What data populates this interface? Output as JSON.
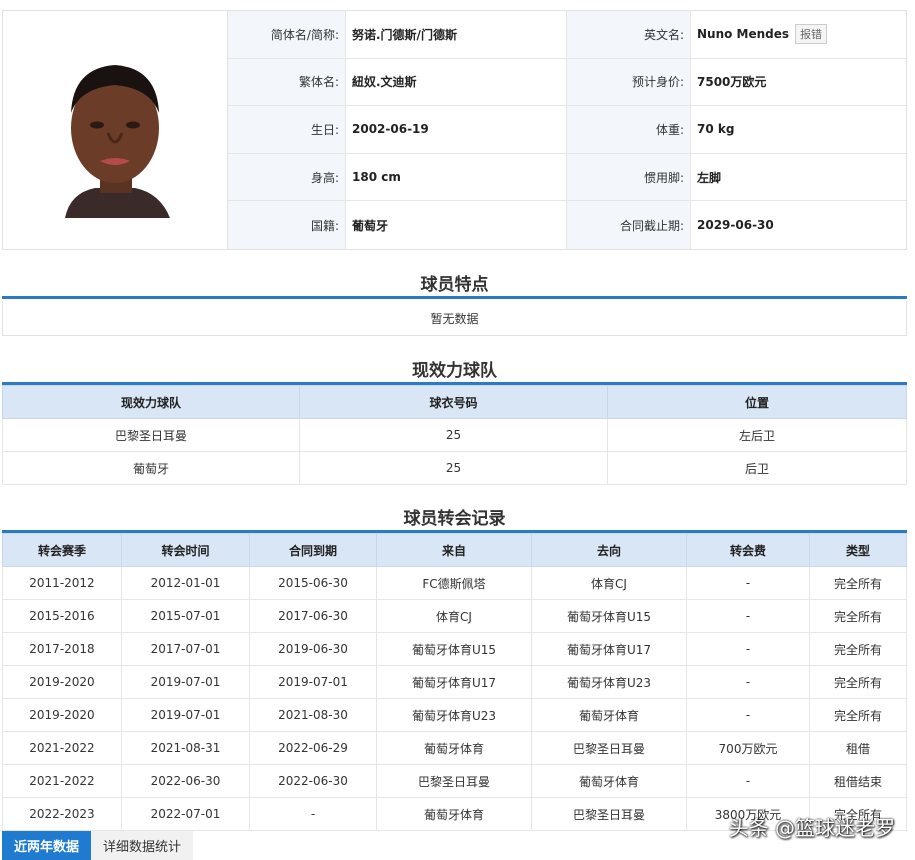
{
  "profile": {
    "rows": [
      {
        "l1": "简体名/简称:",
        "v1": "努诺.门德斯/门德斯",
        "l2": "英文名:",
        "v2": "Nuno Mendes"
      },
      {
        "l1": "繁体名:",
        "v1": "紐奴.文迪斯",
        "l2": "预计身价:",
        "v2": "7500万欧元"
      },
      {
        "l1": "生日:",
        "v1": "2002-06-19",
        "l2": "体重:",
        "v2": "70 kg"
      },
      {
        "l1": "身高:",
        "v1": "180 cm",
        "l2": "惯用脚:",
        "v2": "左脚"
      },
      {
        "l1": "国籍:",
        "v1": "葡萄牙",
        "l2": "合同截止期:",
        "v2": "2029-06-30"
      }
    ],
    "report_label": "报错"
  },
  "features": {
    "title": "球员特点",
    "empty": "暂无数据"
  },
  "current_teams": {
    "title": "现效力球队",
    "headers": [
      "现效力球队",
      "球衣号码",
      "位置"
    ],
    "rows": [
      [
        "巴黎圣日耳曼",
        "25",
        "左后卫"
      ],
      [
        "葡萄牙",
        "25",
        "后卫"
      ]
    ]
  },
  "transfers": {
    "title": "球员转会记录",
    "headers": [
      "转会赛季",
      "转会时间",
      "合同到期",
      "来自",
      "去向",
      "转会费",
      "类型"
    ],
    "rows": [
      [
        "2011-2012",
        "2012-01-01",
        "2015-06-30",
        "FC德斯佩塔",
        "体育CJ",
        "-",
        "完全所有"
      ],
      [
        "2015-2016",
        "2015-07-01",
        "2017-06-30",
        "体育CJ",
        "葡萄牙体育U15",
        "-",
        "完全所有"
      ],
      [
        "2017-2018",
        "2017-07-01",
        "2019-06-30",
        "葡萄牙体育U15",
        "葡萄牙体育U17",
        "-",
        "完全所有"
      ],
      [
        "2019-2020",
        "2019-07-01",
        "2019-07-01",
        "葡萄牙体育U17",
        "葡萄牙体育U23",
        "-",
        "完全所有"
      ],
      [
        "2019-2020",
        "2019-07-01",
        "2021-08-30",
        "葡萄牙体育U23",
        "葡萄牙体育",
        "-",
        "完全所有"
      ],
      [
        "2021-2022",
        "2021-08-31",
        "2022-06-29",
        "葡萄牙体育",
        "巴黎圣日耳曼",
        "700万欧元",
        "租借"
      ],
      [
        "2021-2022",
        "2022-06-30",
        "2022-06-30",
        "巴黎圣日耳曼",
        "葡萄牙体育",
        "-",
        "租借结束"
      ],
      [
        "2022-2023",
        "2022-07-01",
        "-",
        "葡萄牙体育",
        "巴黎圣日耳曼",
        "3800万欧元",
        "完全所有"
      ]
    ]
  },
  "tabs": [
    "近两年数据",
    "详细数据统计"
  ],
  "watermark": "头条 @篮球迷老罗"
}
